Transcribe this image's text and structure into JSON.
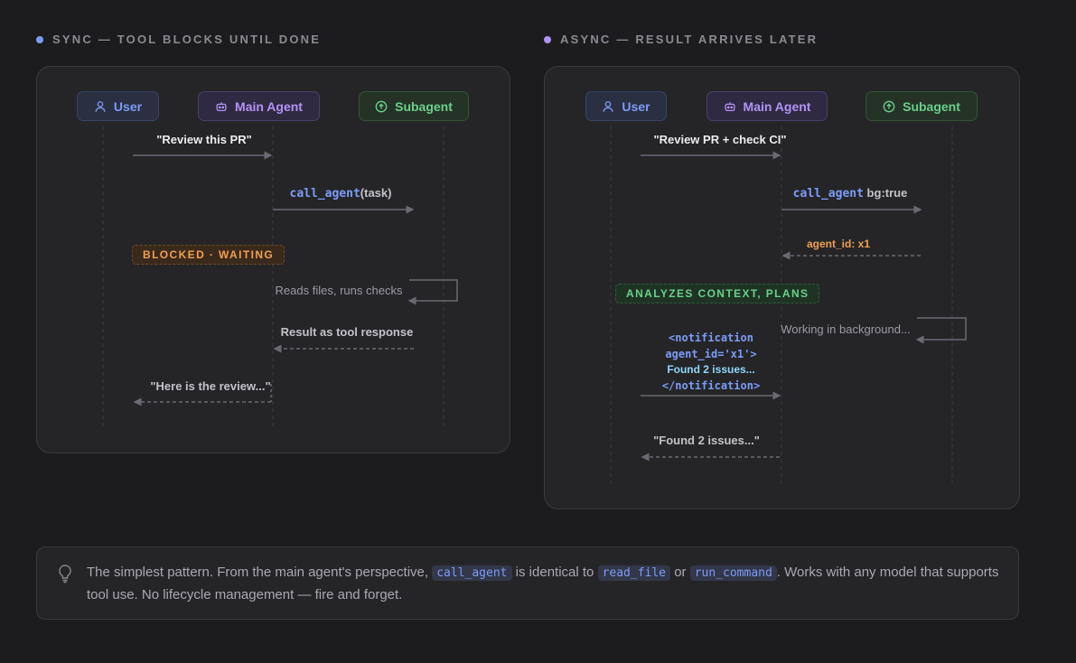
{
  "sync": {
    "title": "SYNC — TOOL BLOCKS UNTIL DONE",
    "dot_color": "#7c9cf5",
    "actors": {
      "user": "User",
      "main": "Main Agent",
      "sub": "Subagent"
    },
    "msg_review": "\"Review this PR\"",
    "call_code": "call_agent",
    "call_rest": "(task)",
    "blocked": "BLOCKED · WAITING",
    "reads": "Reads files, runs checks",
    "result": "Result as tool response",
    "reply": "\"Here is the review...\""
  },
  "async": {
    "title": "ASYNC — RESULT ARRIVES LATER",
    "dot_color": "#b393f5",
    "actors": {
      "user": "User",
      "main": "Main Agent",
      "sub": "Subagent"
    },
    "msg_review": "\"Review PR + check CI\"",
    "call_code": "call_agent",
    "call_rest": " bg:true",
    "agent_id": "agent_id: x1",
    "analyzes": "ANALYZES CONTEXT, PLANS",
    "working": "Working in background...",
    "notif_open": "<notification",
    "notif_attr": "agent_id='x1'>",
    "notif_body": "Found 2 issues...",
    "notif_close": "</notification>",
    "reply": "\"Found 2 issues...\""
  },
  "info": {
    "text1": "The simplest pattern. From the main agent's perspective,",
    "code1": "call_agent",
    "text2": "is identical to",
    "code2": "read_file",
    "text3": "or",
    "code3": "run_command",
    "text4": ". Works with any model that supports tool use. No lifecycle management — fire and forget.",
    "icon": "lightbulb-icon"
  }
}
